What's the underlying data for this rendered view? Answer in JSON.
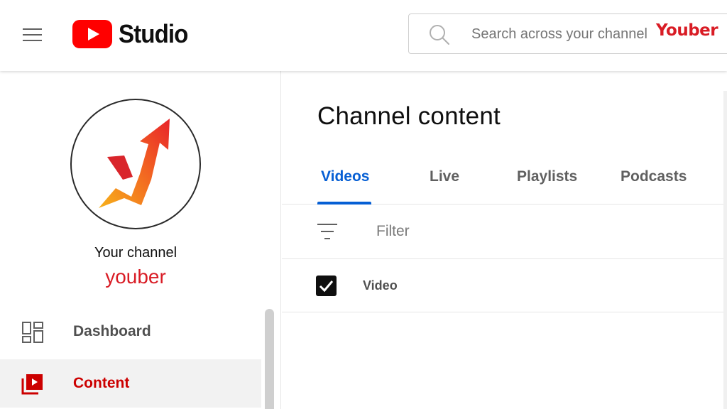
{
  "header": {
    "logo_text": "Studio",
    "search_placeholder": "Search across your channel",
    "watermark": "Youber"
  },
  "sidebar": {
    "channel_label": "Your channel",
    "channel_name": "youber",
    "items": [
      {
        "label": "Dashboard",
        "icon": "dashboard-icon",
        "active": false
      },
      {
        "label": "Content",
        "icon": "content-icon",
        "active": true
      }
    ]
  },
  "main": {
    "title": "Channel content",
    "tabs": [
      {
        "label": "Videos",
        "active": true
      },
      {
        "label": "Live",
        "active": false
      },
      {
        "label": "Playlists",
        "active": false
      },
      {
        "label": "Podcasts",
        "active": false
      }
    ],
    "filter_placeholder": "Filter",
    "table": {
      "columns": [
        "Video"
      ],
      "select_all_checked": true
    }
  },
  "colors": {
    "brand_red": "#ff0000",
    "channel_red": "#d91c25",
    "active_tab_blue": "#065fd4",
    "active_nav_text": "#cc0000"
  }
}
